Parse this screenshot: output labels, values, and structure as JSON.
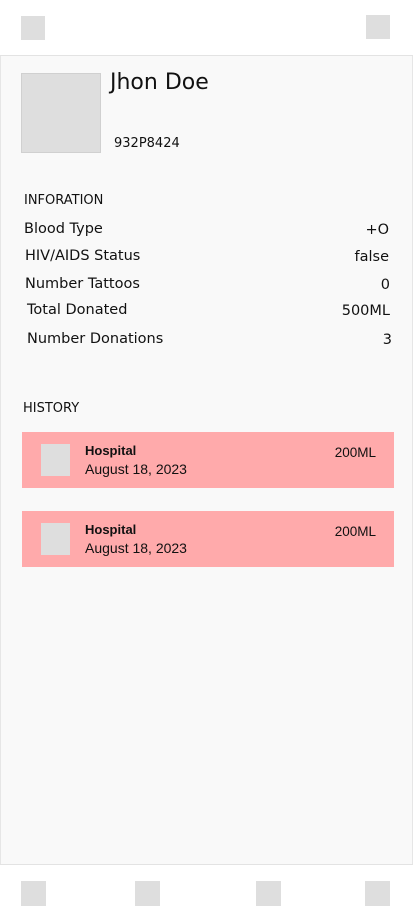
{
  "topbar": {
    "left_icon": "menu-icon",
    "right_icon": "settings-icon"
  },
  "profile": {
    "name": "Jhon Doe",
    "donor_id": "932P8424",
    "avatar_icon": "avatar-placeholder"
  },
  "info": {
    "title": "INFORATION",
    "rows": [
      {
        "label": "Blood Type",
        "value": "+O"
      },
      {
        "label": "HIV/AIDS Status",
        "value": "false"
      },
      {
        "label": "Number Tattoos",
        "value": "0"
      },
      {
        "label": "Total Donated",
        "value": "500ML"
      },
      {
        "label": "Number Donations",
        "value": "3"
      }
    ]
  },
  "history": {
    "title": "HISTORY",
    "items": [
      {
        "place": "Hospital",
        "date": "August 18, 2023",
        "amount": "200ML"
      },
      {
        "place": "Hospital",
        "date": "August 18, 2023",
        "amount": "200ML"
      }
    ]
  },
  "bottom_nav": {
    "items": [
      {
        "icon": "home-icon"
      },
      {
        "icon": "search-icon"
      },
      {
        "icon": "calendar-icon"
      },
      {
        "icon": "profile-icon"
      }
    ]
  },
  "colors": {
    "history_card": "#ffaaab",
    "placeholder": "#dedede",
    "background": "#f9f9f9"
  }
}
